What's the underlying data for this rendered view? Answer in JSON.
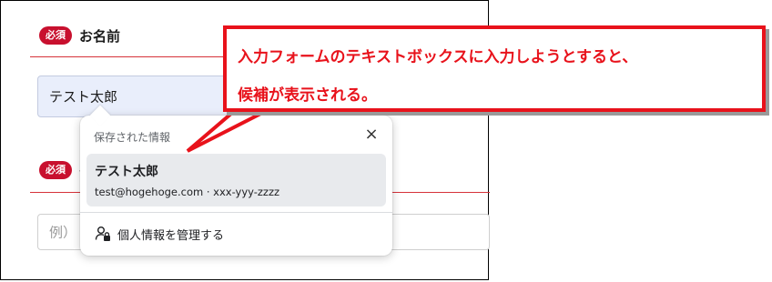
{
  "form": {
    "required_badge": "必須",
    "name_field": {
      "label": "お名前",
      "value": "テスト太郎"
    },
    "second_field": {
      "label": "",
      "partial_label": "、",
      "placeholder": "例）"
    }
  },
  "autofill_popup": {
    "title": "保存された情報",
    "close_icon": "×",
    "suggestion": {
      "name": "テスト太郎",
      "detail": "test@hogehoge.com · xxx-yyy-zzzz"
    },
    "manage_label": "個人情報を管理する",
    "manage_icon": "person-manage-icon"
  },
  "callout": {
    "line1": "入力フォームのテキストボックスに入力しようとすると、",
    "line2": "候補が表示される。"
  },
  "colors": {
    "accent_red": "#e8121b",
    "badge_red": "#c8102e",
    "input_fill": "#e9eefb",
    "suggestion_fill": "#e8eaed"
  }
}
